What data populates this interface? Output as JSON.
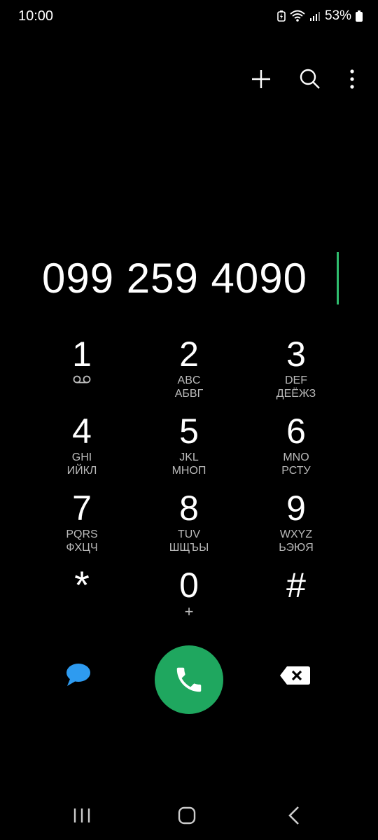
{
  "status": {
    "time": "10:00",
    "battery_pct": "53%"
  },
  "toolbar": {
    "icons": [
      "plus-icon",
      "search-icon",
      "more-vert-icon"
    ]
  },
  "dial": {
    "number": "099 259 4090"
  },
  "keys": [
    {
      "digit": "1",
      "sub1": "",
      "sub2": "",
      "icon": "voicemail-icon"
    },
    {
      "digit": "2",
      "sub1": "ABC",
      "sub2": "АБВГ"
    },
    {
      "digit": "3",
      "sub1": "DEF",
      "sub2": "ДЕЁЖЗ"
    },
    {
      "digit": "4",
      "sub1": "GHI",
      "sub2": "ИЙКЛ"
    },
    {
      "digit": "5",
      "sub1": "JKL",
      "sub2": "МНОП"
    },
    {
      "digit": "6",
      "sub1": "MNO",
      "sub2": "РСТУ"
    },
    {
      "digit": "7",
      "sub1": "PQRS",
      "sub2": "ФХЦЧ"
    },
    {
      "digit": "8",
      "sub1": "TUV",
      "sub2": "ШЩЪЫ"
    },
    {
      "digit": "9",
      "sub1": "WXYZ",
      "sub2": "ЬЭЮЯ"
    },
    {
      "digit": "*",
      "sub1": "",
      "sub2": ""
    },
    {
      "digit": "0",
      "sub1": "+",
      "sub2": ""
    },
    {
      "digit": "#",
      "sub1": "",
      "sub2": ""
    }
  ],
  "colors": {
    "call": "#1fa75f",
    "cursor": "#2fbd6e",
    "message": "#2e9bf0"
  }
}
